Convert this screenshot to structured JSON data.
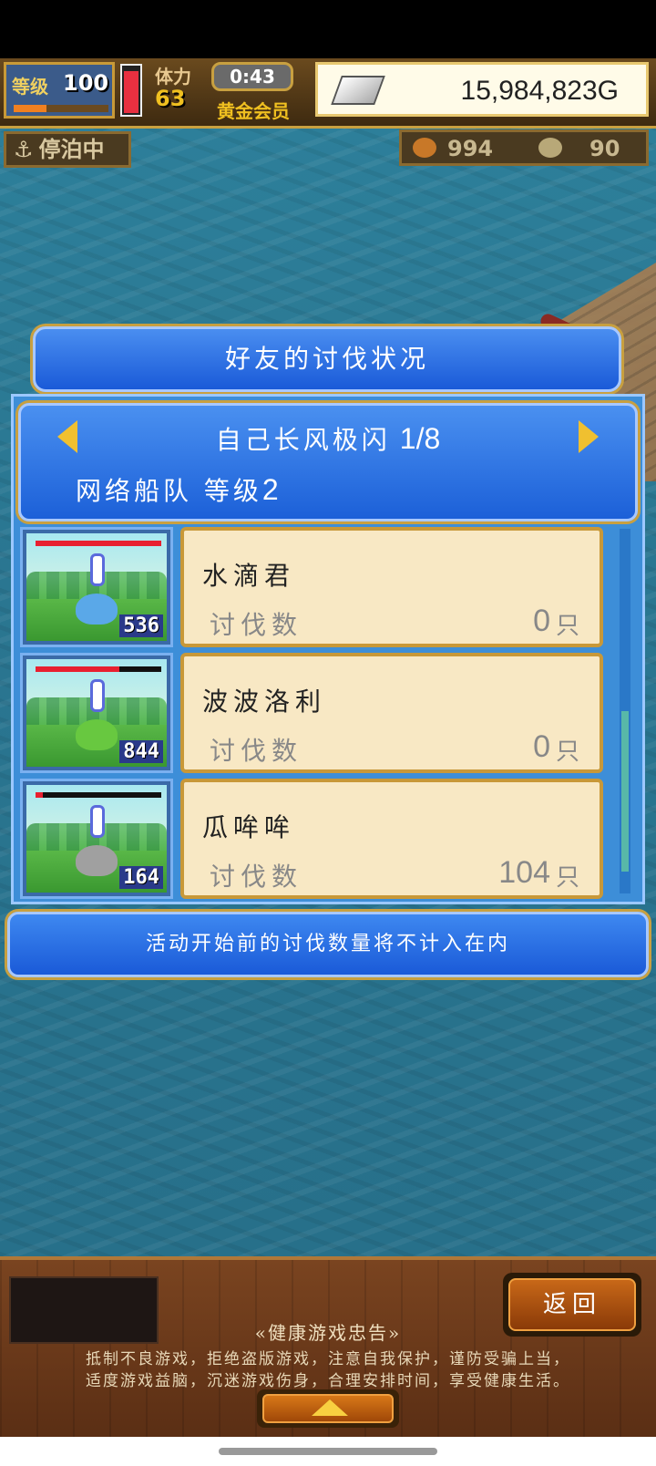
{
  "hud": {
    "level_label": "等级",
    "level_value": "100",
    "exp_fraction": 0.35,
    "hp_fraction": 0.85,
    "stamina_label": "体力",
    "stamina_value": "63",
    "timer": "0:43",
    "membership": "黄金会员",
    "money": "15,984,823G",
    "anchor_status": "停泊中",
    "resource_1": "994",
    "resource_2": "90"
  },
  "panel": {
    "title": "好友的讨伐状况",
    "friend_name": "自己长风极闪",
    "page_indicator": "1/8",
    "fleet_label": "网络船队 等级",
    "fleet_level": "2"
  },
  "monsters": [
    {
      "name": "水滴君",
      "kill_label": "讨伐数",
      "kills": "0",
      "unit": "只",
      "count": "536",
      "hp_fraction": 1.0,
      "color": "#5aa8e8"
    },
    {
      "name": "波波洛利",
      "kill_label": "讨伐数",
      "kills": "0",
      "unit": "只",
      "count": "844",
      "hp_fraction": 0.67,
      "color": "#68c840"
    },
    {
      "name": "瓜哞哞",
      "kill_label": "讨伐数",
      "kills": "104",
      "unit": "只",
      "count": "164",
      "hp_fraction": 0.06,
      "color": "#a0a0a0"
    }
  ],
  "note": "活动开始前的讨伐数量将不计入在内",
  "bottom": {
    "back_label": "返回",
    "advice_title": "«健康游戏忠告»",
    "advice_line1": "抵制不良游戏，拒绝盗版游戏，注意自我保护，谨防受骗上当，",
    "advice_line2": "适度游戏益脑，沉迷游戏伤身，合理安排时间，享受健康生活。"
  }
}
